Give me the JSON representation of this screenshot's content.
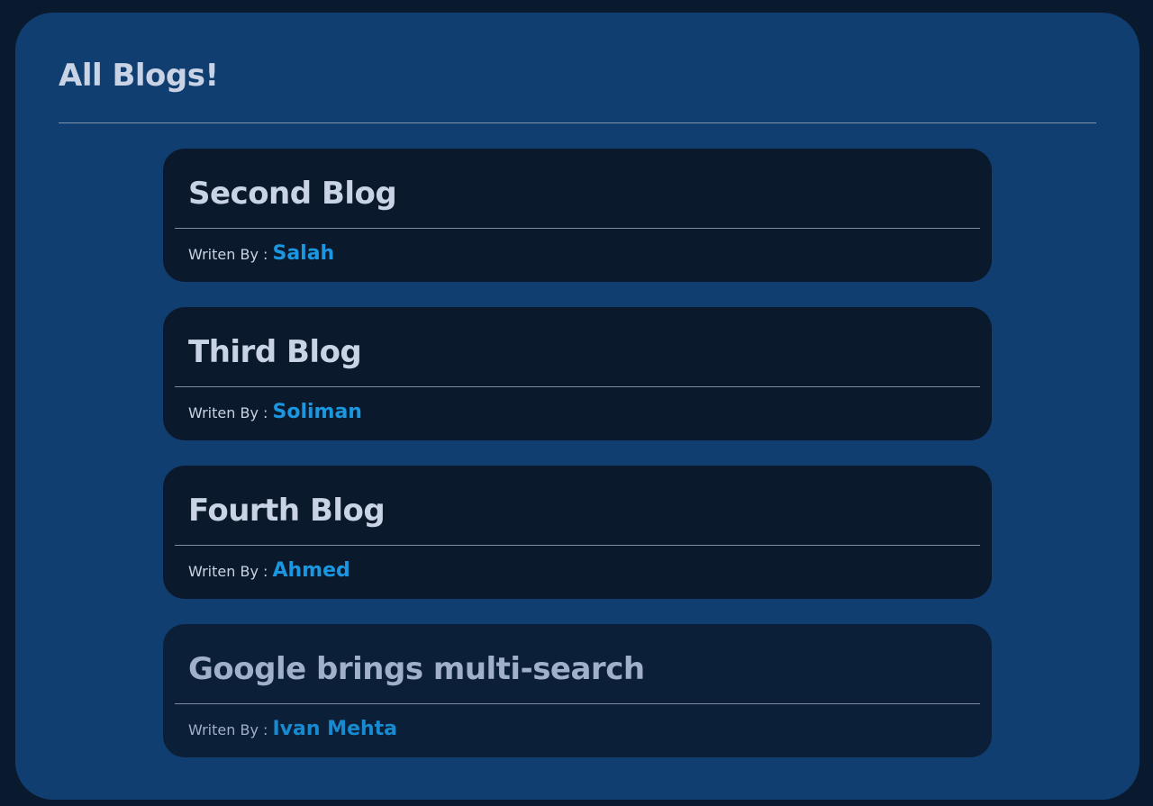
{
  "page": {
    "title": "All Blogs!"
  },
  "byline_label": "Writen By :",
  "blogs": [
    {
      "title": "Second Blog",
      "author": "Salah"
    },
    {
      "title": "Third Blog",
      "author": "Soliman"
    },
    {
      "title": "Fourth Blog",
      "author": "Ahmed"
    },
    {
      "title": "Google brings multi-search",
      "author": "Ivan Mehta"
    }
  ],
  "colors": {
    "background": "#0a1a2e",
    "panel": "#113e70",
    "card": "#0a192b",
    "text": "#c9d3e6",
    "author_accent": "#1b96e0"
  }
}
